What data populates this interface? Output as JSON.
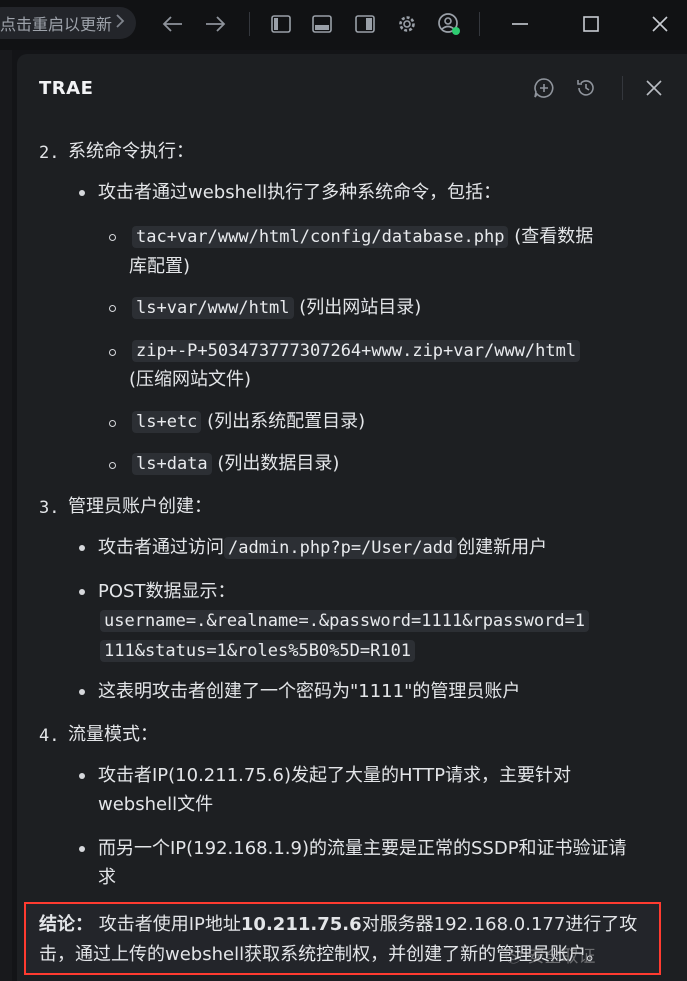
{
  "titlebar": {
    "update_text": "点击重启以更新",
    "icons": [
      "chevron-right-icon",
      "back-arrow-icon",
      "forward-arrow-icon",
      "sidebar-left-icon",
      "panel-bottom-icon",
      "sidebar-right-icon",
      "gear-icon",
      "account-icon",
      "minimize-icon",
      "maximize-icon",
      "close-icon"
    ]
  },
  "panel": {
    "title": "TRAE",
    "icons": [
      "new-chat-icon",
      "history-icon",
      "close-icon"
    ]
  },
  "content": {
    "s2": {
      "num": "2.",
      "title": "系统命令执行："
    },
    "s2_b1": "攻击者通过webshell执行了多种系统命令，包括：",
    "cmd1": {
      "code": "tac+var/www/html/config/database.php",
      "desc1": "(查看数据",
      "desc2": "库配置)"
    },
    "cmd2": {
      "code": "ls+var/www/html",
      "desc": "(列出网站目录)"
    },
    "cmd3": {
      "code": "zip+-P+503473777307264+www.zip+var/www/html",
      "desc": "(压缩网站文件)"
    },
    "cmd4": {
      "code": "ls+etc",
      "desc": "(列出系统配置目录)"
    },
    "cmd5": {
      "code": "ls+data",
      "desc": "(列出数据目录)"
    },
    "s3": {
      "num": "3.",
      "title": "管理员账户创建："
    },
    "s3_b1": {
      "pre": "攻击者通过访问",
      "code": "/admin.php?p=/User/add",
      "post": "创建新用户"
    },
    "s3_b2": {
      "label": "POST数据显示：",
      "code1": "username=.&realname=.&password=1111&rpassword=1",
      "code2": "111&status=1&roles%5B0%5D=R101"
    },
    "s3_b3": "这表明攻击者创建了一个密码为\"1111\"的管理员账户",
    "s4": {
      "num": "4.",
      "title": "流量模式："
    },
    "s4_b1": {
      "l1": "攻击者IP(10.211.75.6)发起了大量的HTTP请求，主要针对",
      "l2": "webshell文件"
    },
    "s4_b2": {
      "l1": "而另一个IP(192.168.1.9)的流量主要是正常的SSDP和证书验证请",
      "l2": "求"
    },
    "conclusion": {
      "label": "结论：",
      "pre": "攻击者使用IP地址",
      "ip": "10.211.75.6",
      "post": "对服务器192.168.0.177进行了攻",
      "l2": "击，通过上传的webshell获取系统控制权，并创建了新的管理员账户。"
    },
    "watermark": "Ⓢ 安全取证"
  },
  "colors": {
    "background": "#131417",
    "panel": "#1d1f22",
    "highlight_border": "#ff3b30",
    "status_dot": "#2ecc71"
  }
}
